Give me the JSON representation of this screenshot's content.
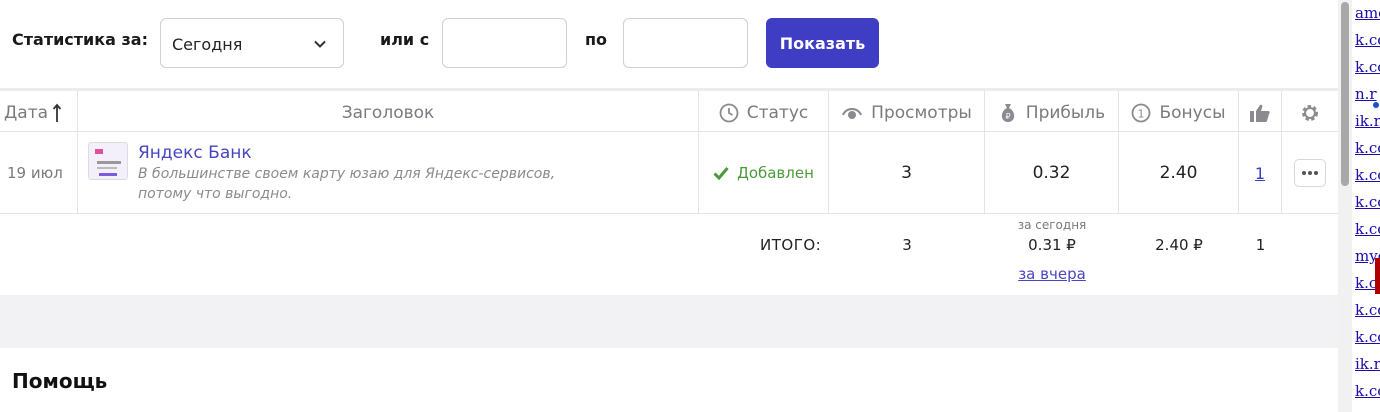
{
  "filter": {
    "label": "Статистика за:",
    "period_value": "Сегодня",
    "or_label": "или с",
    "from_value": "",
    "to_label": "по",
    "to_value": "",
    "show_button": "Показать"
  },
  "table": {
    "headers": {
      "date": "Дата",
      "title": "Заголовок",
      "status": "Статус",
      "views": "Просмотры",
      "profit": "Прибыль",
      "bonus": "Бонусы"
    },
    "rows": [
      {
        "date": "19 июл",
        "title": "Яндекс Банк",
        "description": "В большинстве своем карту юзаю для Яндекс-сервисов, потому что выгодно.",
        "status": "Добавлен",
        "views": "3",
        "profit": "0.32",
        "bonus": "2.40",
        "likes": "1"
      }
    ],
    "totals": {
      "label": "ИТОГО:",
      "views": "3",
      "profit_caption": "за сегодня",
      "profit": "0.31 ₽",
      "yesterday_link": "за вчера",
      "bonus": "2.40 ₽",
      "likes": "1"
    }
  },
  "help": {
    "title": "Помощь"
  },
  "side_panel": {
    "links": [
      "ame",
      "k.co",
      "k.co",
      "n.r",
      "ik.r",
      "k.co",
      "k.co",
      "k.co",
      "k.co",
      "myo",
      "k.co",
      "k.co",
      "k.co",
      "ik.r",
      "k.co"
    ]
  },
  "colors": {
    "accent": "#3f3dc4",
    "link": "#4845c0",
    "status_ok": "#4a9a3a",
    "muted": "#7a7a80"
  }
}
